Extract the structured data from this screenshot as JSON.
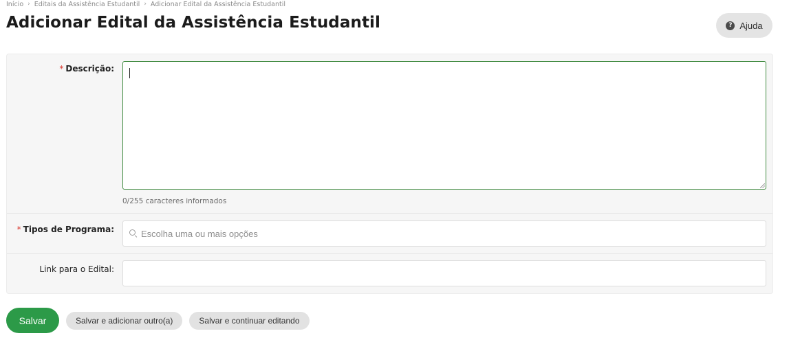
{
  "breadcrumb": {
    "items": [
      "Início",
      "Editais da Assistência Estudantil",
      "Adicionar Edital da Assistência Estudantil"
    ],
    "separator": "›"
  },
  "page": {
    "title": "Adicionar Edital da Assistência Estudantil",
    "help_label": "Ajuda",
    "help_icon": "question-circle-icon"
  },
  "form": {
    "required_marker": "*",
    "descricao": {
      "label": "Descrição:",
      "value": "",
      "counter": "0/255 caracteres informados"
    },
    "tipos_programa": {
      "label": "Tipos de Programa:",
      "placeholder": "Escolha uma ou mais opções",
      "icon": "search-icon"
    },
    "link_edital": {
      "label": "Link para o Edital:",
      "value": ""
    }
  },
  "actions": {
    "save": "Salvar",
    "save_add_another": "Salvar e adicionar outro(a)",
    "save_continue": "Salvar e continuar editando"
  },
  "colors": {
    "primary": "#2c9a48",
    "required": "#d9342b",
    "focus_border": "#3f8a3f"
  }
}
